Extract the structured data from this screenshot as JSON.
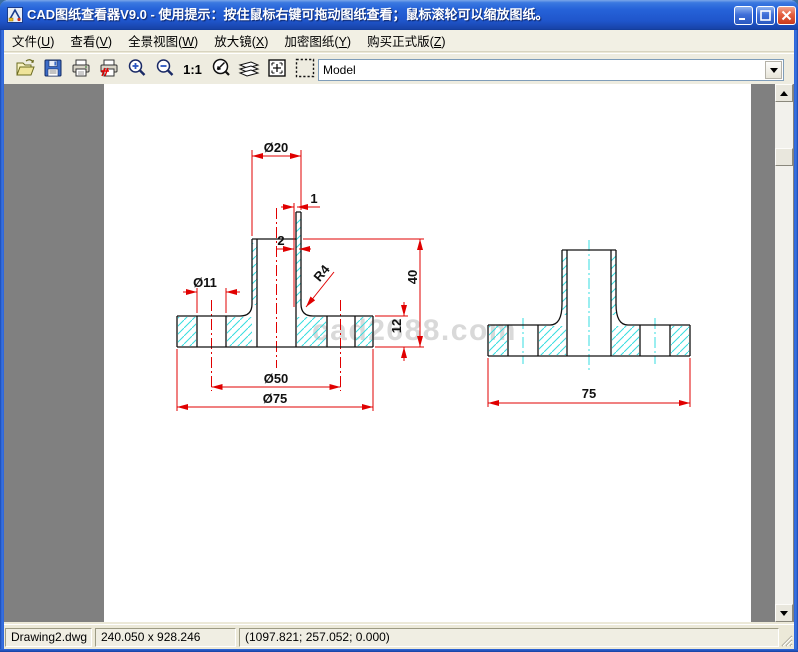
{
  "window": {
    "title": "CAD图纸查看器V9.0 - 使用提示：按住鼠标右键可拖动图纸查看；鼠标滚轮可以缩放图纸。"
  },
  "menu": {
    "items": [
      {
        "pre": "文件(",
        "key": "U",
        "post": ")"
      },
      {
        "pre": "查看(",
        "key": "V",
        "post": ")"
      },
      {
        "pre": "全景视图(",
        "key": "W",
        "post": ")"
      },
      {
        "pre": "放大镜(",
        "key": "X",
        "post": ")"
      },
      {
        "pre": "加密图纸(",
        "key": "Y",
        "post": ")"
      },
      {
        "pre": "购买正式版(",
        "key": "Z",
        "post": ")"
      }
    ]
  },
  "toolbar": {
    "icons": [
      "open-file",
      "save",
      "print",
      "print-disabled",
      "zoom-in",
      "zoom-out",
      "zoom-1-1",
      "pan-view",
      "layers",
      "fit-to-window",
      "zoom-window"
    ],
    "scale_label": "1:1",
    "layout_select": {
      "value": "Model"
    }
  },
  "drawing": {
    "watermark": "cad2688.com",
    "colors": {
      "dimension": "#e00000",
      "hatch": "#35dde0",
      "outline": "#111111",
      "paper": "#ffffff",
      "canvas": "#808080"
    },
    "dims": {
      "top_diameter": "Ø20",
      "lip": "1",
      "wall": "2",
      "hole_diameter": "Ø11",
      "fillet_radius": "R4",
      "height": "40",
      "flange_thickness": "12",
      "bolt_circle": "Ø50",
      "outer_diameter": "Ø75",
      "side_width": "75"
    }
  },
  "status": {
    "filename": "Drawing2.dwg",
    "extents": "240.050 x 928.246",
    "coordinates": "(1097.821; 257.052; 0.000)"
  }
}
